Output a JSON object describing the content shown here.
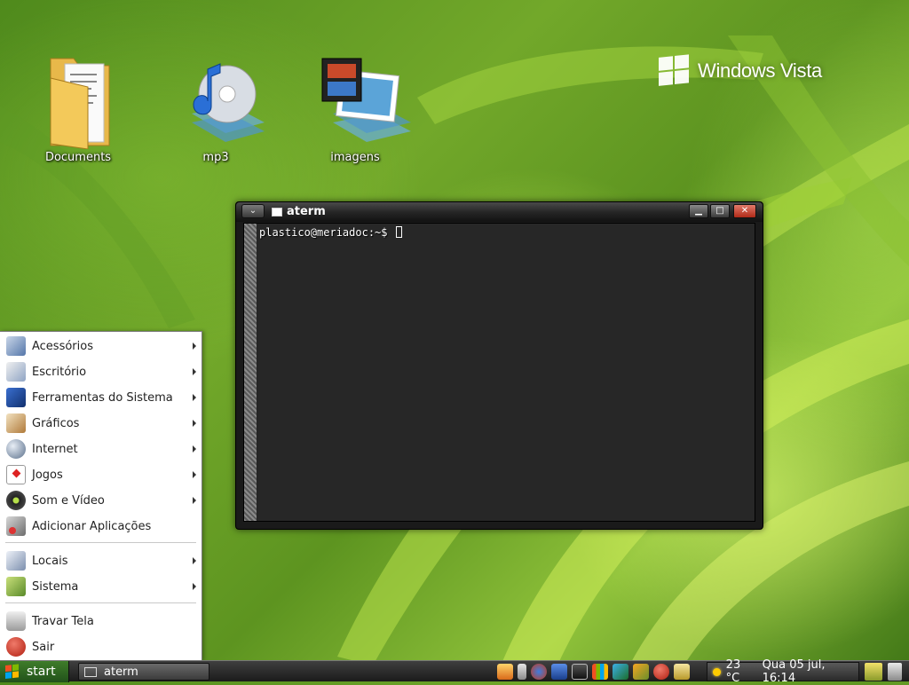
{
  "desktop": {
    "icons": [
      {
        "label": "Documents"
      },
      {
        "label": "mp3"
      },
      {
        "label": "imagens"
      }
    ],
    "brand_text": "Windows Vista"
  },
  "terminal": {
    "title": "aterm",
    "prompt": "plastico@meriadoc:~$ ",
    "menu_glyph": "⌄",
    "min_glyph": "▁",
    "max_glyph": "□",
    "close_glyph": "✕"
  },
  "start_menu": {
    "items": [
      {
        "label": "Acessórios",
        "icon": "accessories-icon",
        "submenu": true
      },
      {
        "label": "Escritório",
        "icon": "office-icon",
        "submenu": true
      },
      {
        "label": "Ferramentas do Sistema",
        "icon": "system-tools-icon",
        "submenu": true
      },
      {
        "label": "Gráficos",
        "icon": "graphics-icon",
        "submenu": true
      },
      {
        "label": "Internet",
        "icon": "internet-globe-icon",
        "submenu": true
      },
      {
        "label": "Jogos",
        "icon": "games-cards-icon",
        "submenu": true
      },
      {
        "label": "Som e Vídeo",
        "icon": "sound-video-icon",
        "submenu": true
      },
      {
        "label": "Adicionar Aplicações",
        "icon": "add-applications-icon",
        "submenu": false
      },
      {
        "label": "Locais",
        "icon": "places-icon",
        "submenu": true
      },
      {
        "label": "Sistema",
        "icon": "system-icon",
        "submenu": true
      },
      {
        "label": "Travar Tela",
        "icon": "lock-icon",
        "submenu": false
      },
      {
        "label": "Sair",
        "icon": "logout-icon",
        "submenu": false
      }
    ]
  },
  "taskbar": {
    "start_label": "start",
    "task_label": "aterm",
    "weather": "23 °C",
    "clock": "Qua 05 jul, 16:14"
  },
  "colors": {
    "accent_green": "#2f6e22",
    "menu_bg": "#ffffff",
    "taskbar_dark": "#1b1b1b",
    "close_red": "#b02a18"
  }
}
